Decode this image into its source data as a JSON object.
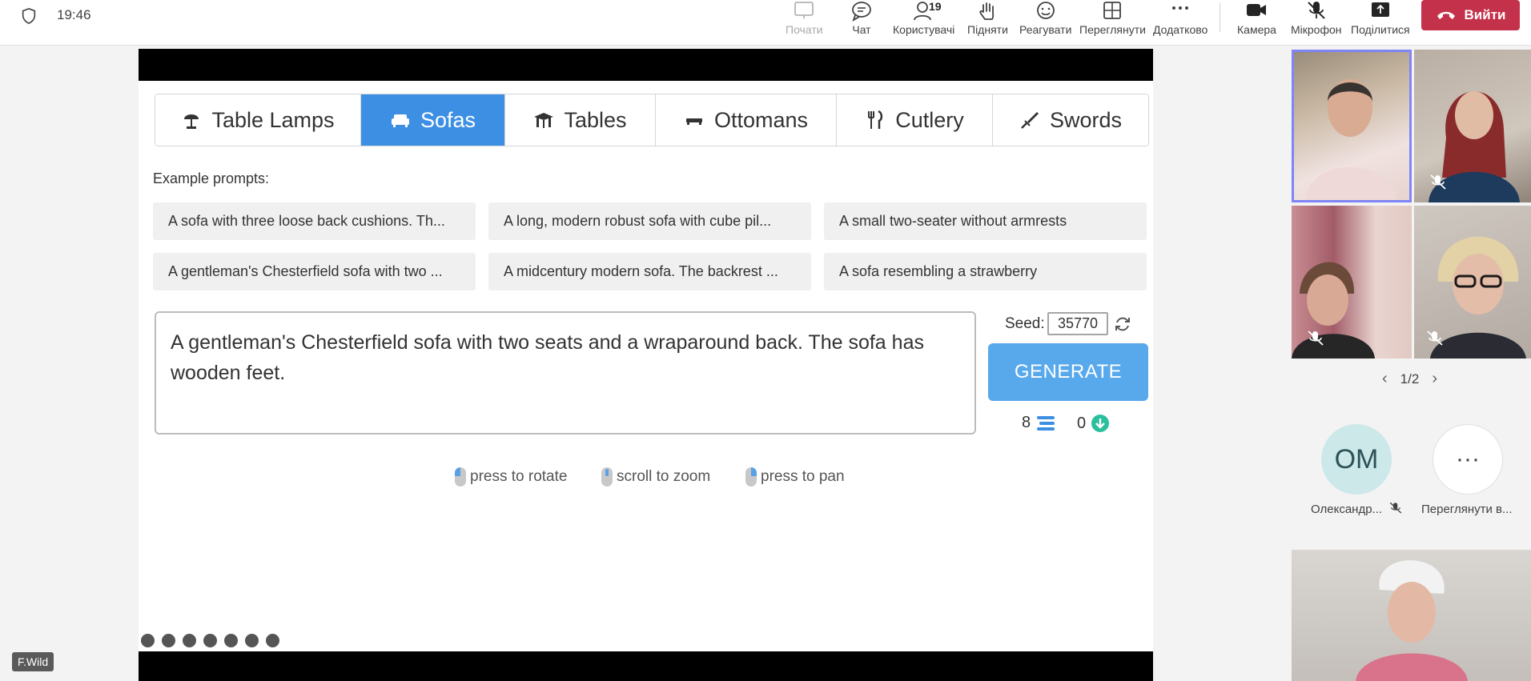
{
  "topbar": {
    "time": "19:46",
    "buttons": [
      {
        "name": "start",
        "label": "Почати"
      },
      {
        "name": "chat",
        "label": "Чат"
      },
      {
        "name": "people",
        "label": "Користувачі",
        "count": "19"
      },
      {
        "name": "raise",
        "label": "Підняти"
      },
      {
        "name": "react",
        "label": "Реагувати"
      },
      {
        "name": "view",
        "label": "Переглянути"
      },
      {
        "name": "more",
        "label": "Додатково"
      },
      {
        "name": "camera",
        "label": "Камера"
      },
      {
        "name": "mic",
        "label": "Мікрофон"
      },
      {
        "name": "share",
        "label": "Поділитися"
      }
    ],
    "leave_label": "Вийти"
  },
  "app": {
    "tabs": [
      {
        "label": "Table Lamps",
        "active": false
      },
      {
        "label": "Sofas",
        "active": true
      },
      {
        "label": "Tables",
        "active": false
      },
      {
        "label": "Ottomans",
        "active": false
      },
      {
        "label": "Cutlery",
        "active": false
      },
      {
        "label": "Swords",
        "active": false
      }
    ],
    "example_label": "Example prompts:",
    "prompts": [
      "A sofa with three loose back cushions. Th...",
      "A long, modern robust sofa with cube pil...",
      "A small two-seater without armrests",
      "A gentleman's Chesterfield sofa with two ...",
      "A midcentury modern sofa. The backrest ...",
      "A sofa resembling a strawberry"
    ],
    "prompt_text": "A gentleman's Chesterfield sofa with two seats and a wraparound back. The sofa has wooden feet.",
    "seed_label": "Seed:",
    "seed_value": "35770",
    "generate_label": "GENERATE",
    "credits": "8",
    "downloads": "0",
    "hints": [
      "press to rotate",
      "scroll to zoom",
      "press to pan"
    ]
  },
  "presenter_label": "F.Wild",
  "gallery": {
    "page": "1/2",
    "participants": [
      {
        "initials": "ОМ",
        "name": "Олександр..."
      },
      {
        "initials": "",
        "name": "Переглянути в..."
      }
    ],
    "more_glyph": "···"
  },
  "colors": {
    "accent_tab": "#3d8fe4",
    "generate": "#58a8ec",
    "leave": "#c4314b",
    "speaking_border": "#7f85f5"
  }
}
